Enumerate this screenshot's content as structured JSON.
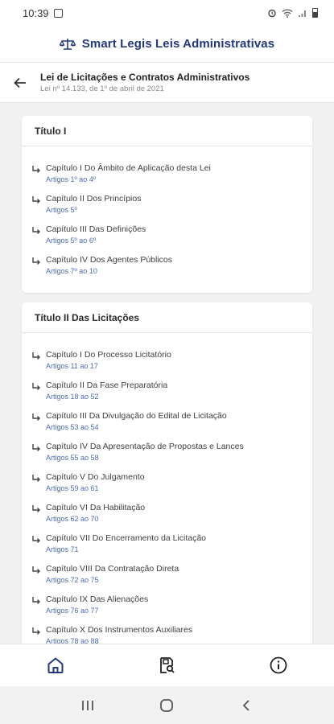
{
  "status_bar": {
    "time": "10:39"
  },
  "app": {
    "title": "Smart Legis Leis Administrativas",
    "brand_color": "#24397a"
  },
  "header": {
    "title": "Lei de Licitações e Contratos Administrativos",
    "subtitle": "Lei nº 14.133, de 1º de abril de 2021"
  },
  "sections": [
    {
      "title": "Título I",
      "chapters": [
        {
          "title": "Capítulo I Do Âmbito de Aplicação desta Lei",
          "articles": "Artigos 1º ao 4º"
        },
        {
          "title": "Capítulo II Dos Princípios",
          "articles": "Artigos 5º"
        },
        {
          "title": "Capítulo III Das Definições",
          "articles": "Artigos 5º ao 6º"
        },
        {
          "title": "Capítulo IV Dos Agentes Públicos",
          "articles": "Artigos 7º ao 10"
        }
      ]
    },
    {
      "title": "Título II Das Licitações",
      "chapters": [
        {
          "title": "Capítulo I Do Processo Licitatório",
          "articles": "Artigos 11 ao 17"
        },
        {
          "title": "Capítulo II Da Fase Preparatória",
          "articles": "Artigos 18 ao 52"
        },
        {
          "title": "Capítulo III Da Divulgação do Edital de Licitação",
          "articles": "Artigos 53 ao 54"
        },
        {
          "title": "Capítulo IV Da Apresentação de Propostas e Lances",
          "articles": "Artigos 55 ao 58"
        },
        {
          "title": "Capítulo V Do Julgamento",
          "articles": "Artigos 59 ao 61"
        },
        {
          "title": "Capítulo VI Da Habilitação",
          "articles": "Artigos 62 ao 70"
        },
        {
          "title": "Capítulo VII Do Encerramento da Licitação",
          "articles": "Artigos 71"
        },
        {
          "title": "Capítulo VIII Da Contratação Direta",
          "articles": "Artigos 72 ao 75"
        },
        {
          "title": "Capítulo IX Das Alienações",
          "articles": "Artigos 76 ao 77"
        },
        {
          "title": "Capítulo X Dos Instrumentos Auxiliares",
          "articles": "Artigos 78 ao 88"
        }
      ]
    }
  ],
  "bottom_nav": [
    {
      "icon": "home-icon",
      "active": true
    },
    {
      "icon": "document-search-icon",
      "active": false
    },
    {
      "icon": "info-icon",
      "active": false
    }
  ]
}
